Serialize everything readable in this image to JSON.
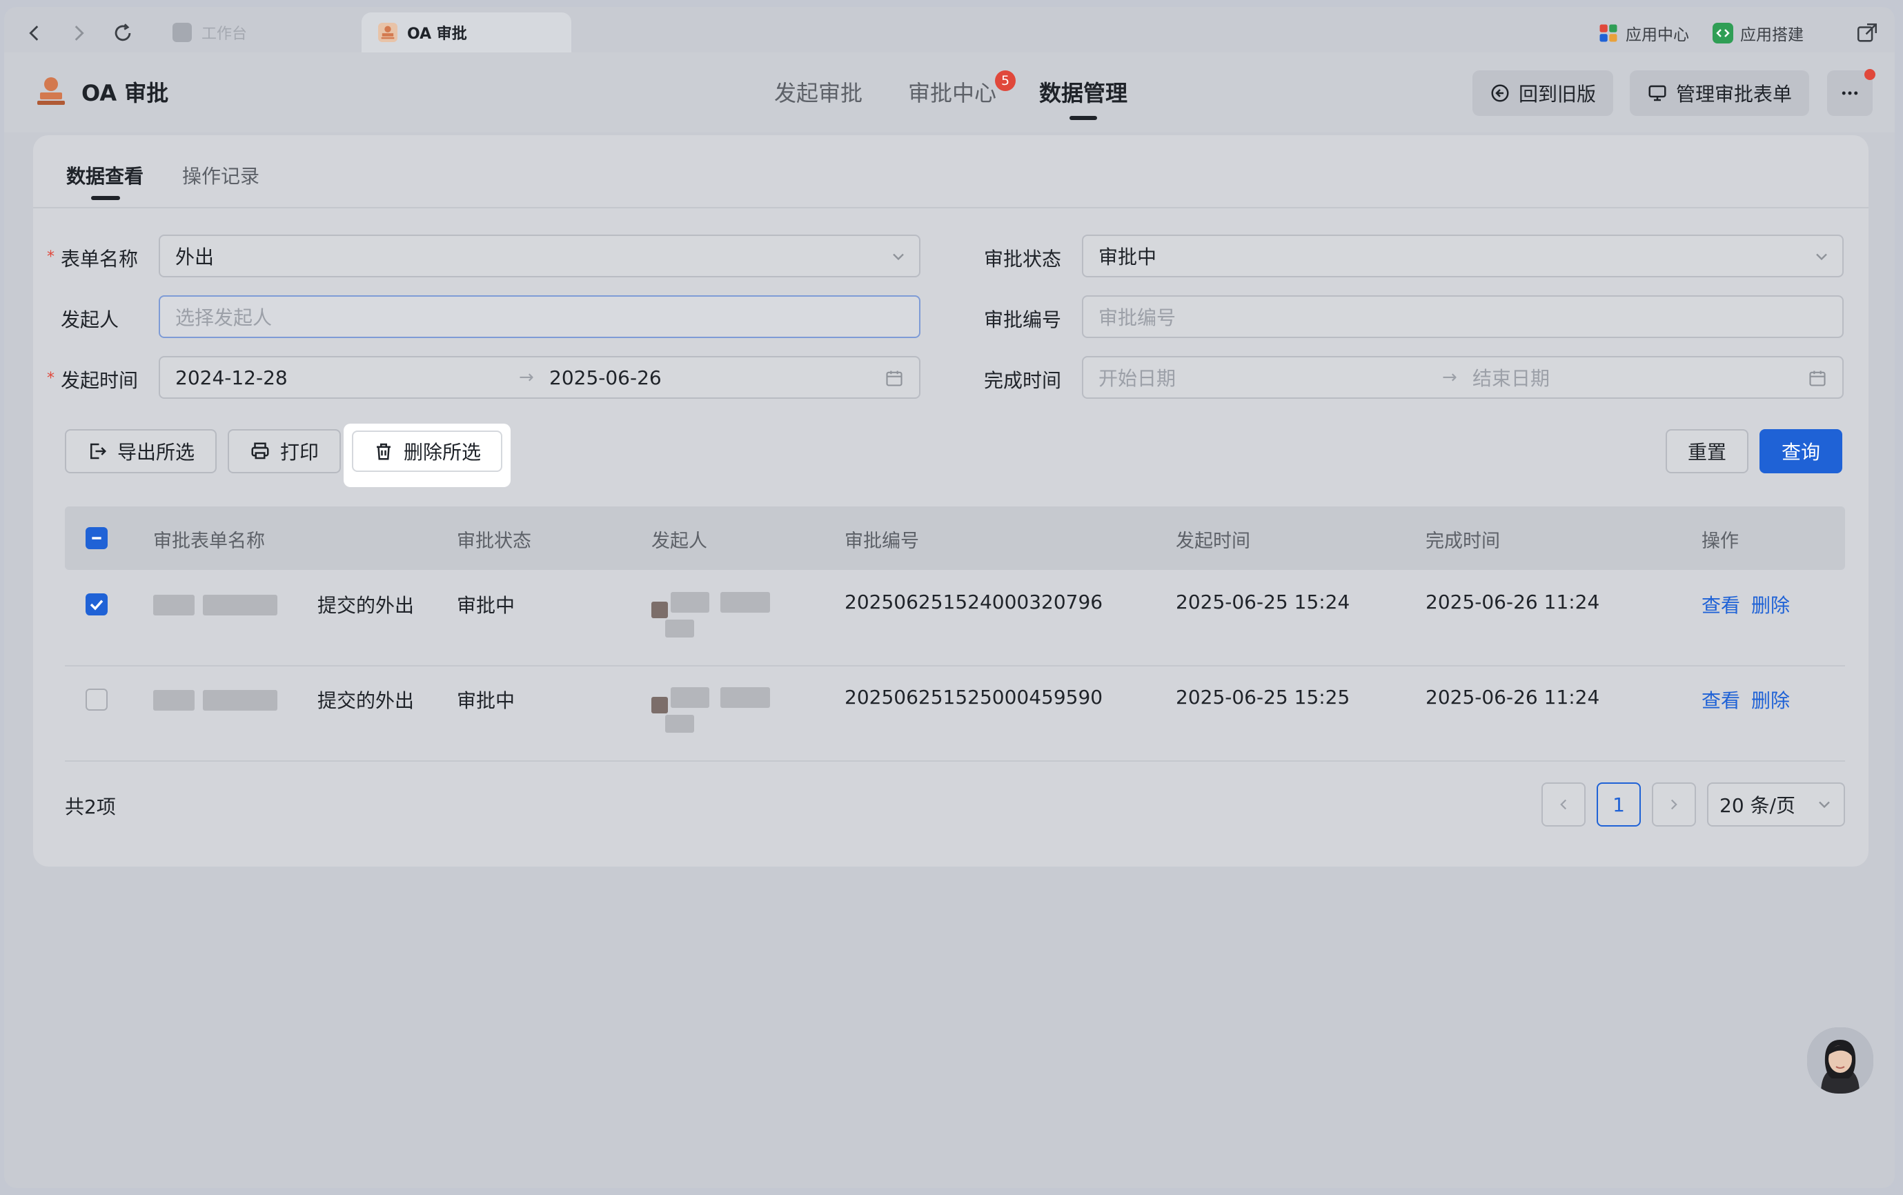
{
  "browser": {
    "tabs": [
      {
        "label": "工作台",
        "active": false
      },
      {
        "label": "OA 审批",
        "active": true
      }
    ],
    "right_links": [
      {
        "label": "应用中心",
        "icon": "app-grid-icon"
      },
      {
        "label": "应用搭建",
        "icon": "code-box-icon"
      }
    ]
  },
  "header": {
    "app_title": "OA 审批",
    "nav": [
      {
        "label": "发起审批",
        "active": false
      },
      {
        "label": "审批中心",
        "active": false,
        "badge": "5"
      },
      {
        "label": "数据管理",
        "active": true
      }
    ],
    "btn_back_old": "回到旧版",
    "btn_manage_forms": "管理审批表单"
  },
  "subtabs": [
    {
      "label": "数据查看",
      "active": true
    },
    {
      "label": "操作记录",
      "active": false
    }
  ],
  "filters": {
    "form_name": {
      "label": "表单名称",
      "required": true,
      "value": "外出"
    },
    "approval_status": {
      "label": "审批状态",
      "value": "审批中"
    },
    "initiator": {
      "label": "发起人",
      "placeholder": "选择发起人"
    },
    "approval_no": {
      "label": "审批编号",
      "placeholder": "审批编号"
    },
    "start_time": {
      "label": "发起时间",
      "required": true,
      "from": "2024-12-28",
      "to": "2025-06-26"
    },
    "finish_time": {
      "label": "完成时间",
      "from_placeholder": "开始日期",
      "to_placeholder": "结束日期"
    }
  },
  "actions": {
    "export": "导出所选",
    "print": "打印",
    "delete": "删除所选",
    "reset": "重置",
    "query": "查询"
  },
  "table": {
    "columns": [
      "审批表单名称",
      "审批状态",
      "发起人",
      "审批编号",
      "发起时间",
      "完成时间",
      "操作"
    ],
    "rows": [
      {
        "checked": true,
        "form": "提交的外出",
        "status": "审批中",
        "no": "202506251524000320796",
        "start": "2025-06-25 15:24",
        "finish": "2025-06-26 11:24",
        "view": "查看",
        "del": "删除"
      },
      {
        "checked": false,
        "form": "提交的外出",
        "status": "审批中",
        "no": "202506251525000459590",
        "start": "2025-06-25 15:25",
        "finish": "2025-06-26 11:24",
        "view": "查看",
        "del": "删除"
      }
    ]
  },
  "footer": {
    "total": "共2项",
    "current_page": "1",
    "page_size": "20 条/页"
  },
  "colors": {
    "primary": "#1f62d6",
    "badge": "#e0483b",
    "required": "#e0483b"
  }
}
